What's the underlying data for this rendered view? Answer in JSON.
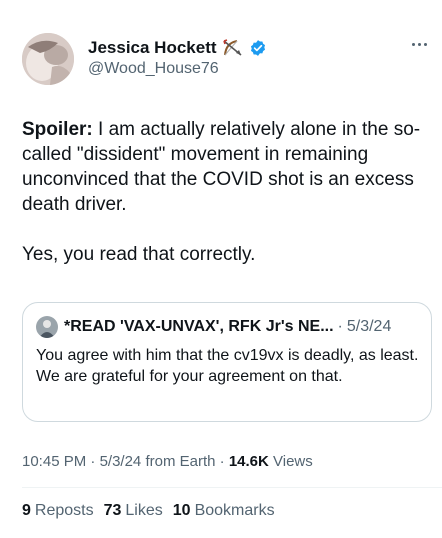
{
  "author": {
    "name": "Jessica Hockett",
    "handle": "@Wood_House76",
    "emoji_icon": "bow-and-arrow-icon",
    "verified_icon": "verified-badge-icon",
    "verified_color": "#1d9bf0"
  },
  "tweet": {
    "spoiler_label": "Spoiler:",
    "paragraph1_rest": " I am actually relatively alone in the so-called \"dissident\" movement in remaining unconvinced that the COVID shot is an excess death driver.",
    "paragraph2": "Yes, you read that correctly."
  },
  "quote": {
    "author_name": "*READ 'VAX-UNVAX', RFK Jr's NE...",
    "separator": "·",
    "date": "5/3/24",
    "text": "You agree with him that the cv19vx is deadly, as least. We are grateful for your agreement on that."
  },
  "meta": {
    "time": "10:45 PM",
    "sep1": " · ",
    "date": "5/3/24",
    "source": " from Earth",
    "sep2": " · ",
    "views_count": "14.6K",
    "views_label": " Views"
  },
  "stats": {
    "reposts_count": "9",
    "reposts_label": "Reposts",
    "likes_count": "73",
    "likes_label": "Likes",
    "bookmarks_count": "10",
    "bookmarks_label": "Bookmarks"
  }
}
